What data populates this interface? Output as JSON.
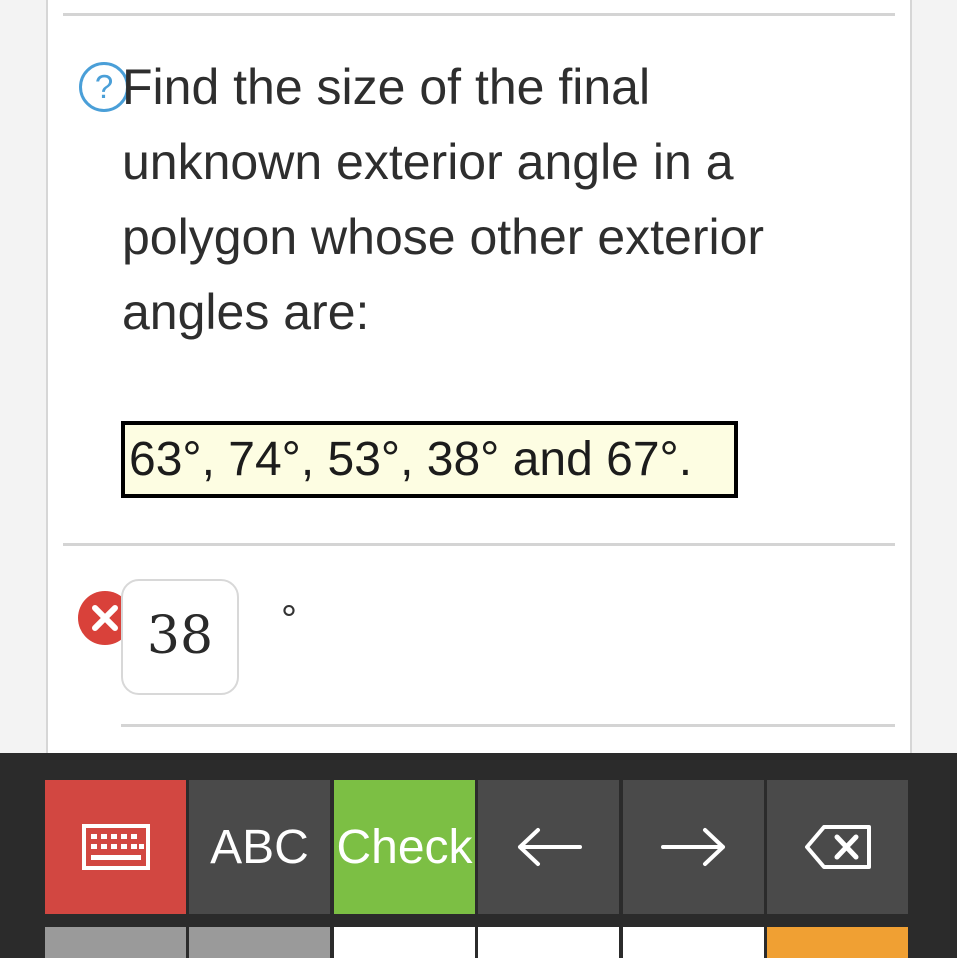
{
  "question": {
    "help_icon_glyph": "?",
    "lines": [
      "Find the size of the final",
      "unknown exterior angle in a",
      "polygon whose other exterior",
      "angles are:"
    ],
    "given_angles": "63°, 74°, 53°, 38° and 67°."
  },
  "answer": {
    "value": "38",
    "unit": "°",
    "status": "incorrect",
    "status_icon": "close-icon"
  },
  "keyboard": {
    "keyboard_toggle_icon": "keyboard-icon",
    "abc_label": "ABC",
    "check_label": "Check",
    "left_arrow_icon": "arrow-left-icon",
    "right_arrow_icon": "arrow-right-icon",
    "backspace_icon": "backspace-icon"
  },
  "colors": {
    "help_blue": "#4a9fd8",
    "error_red": "#d9413a",
    "check_green": "#7cbf44",
    "keyboard_red": "#d24741",
    "highlight_yellow": "#fdfde2"
  }
}
